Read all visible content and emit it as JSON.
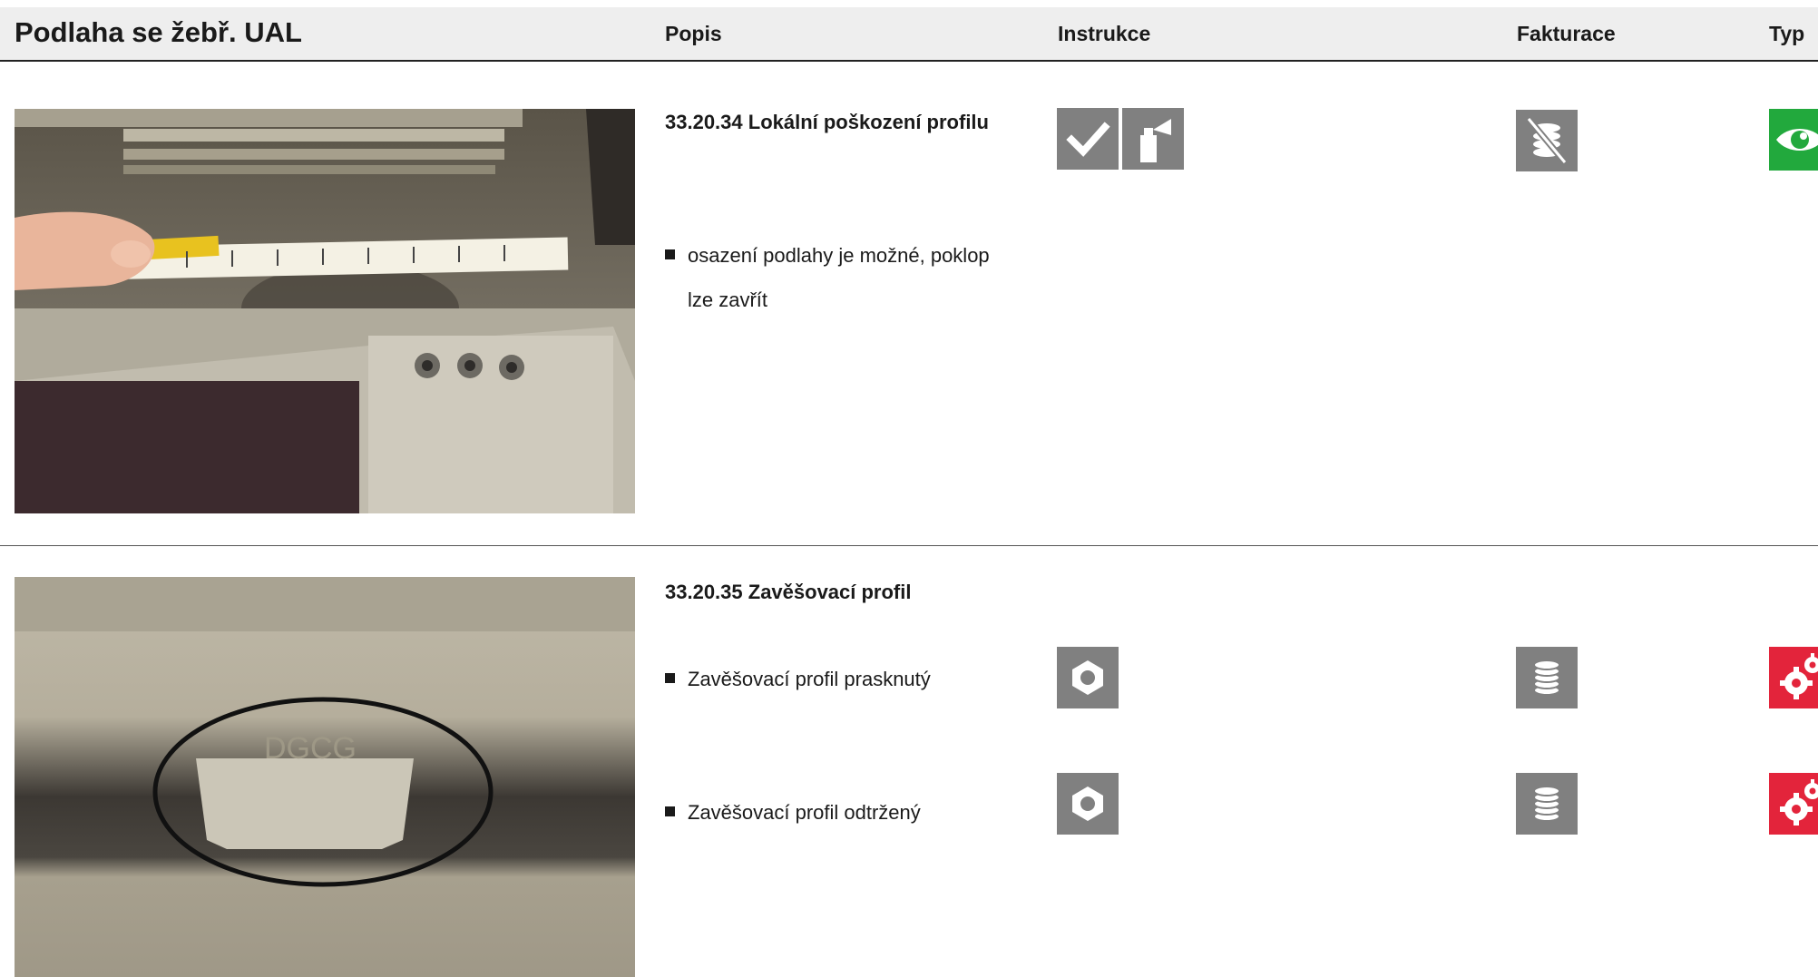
{
  "header": {
    "title": "Podlaha se žebř. UAL",
    "col_popis": "Popis",
    "col_instrukce": "Instrukce",
    "col_fakturace": "Fakturace",
    "col_typ": "Typ"
  },
  "items": [
    {
      "title": "33.20.34 Lokální poškození profilu",
      "bullets": [
        {
          "line1": "osazení podlahy je možné, poklop",
          "line2": "lze zavřít"
        }
      ],
      "instructions": [
        "check-icon",
        "spray-can-icon"
      ],
      "billing": [
        "no-billing-icon"
      ],
      "type": [
        "inspection-eye-icon"
      ]
    },
    {
      "title": "33.20.35 Zavěšovací profil",
      "bullets": [
        {
          "line1": "Zavěšovací profil  prasknutý"
        },
        {
          "line1": "Zavěšovací profil  odtržený"
        }
      ],
      "instructions": [
        "hex-nut-icon",
        "hex-nut-icon"
      ],
      "billing": [
        "coin-stack-icon",
        "coin-stack-icon"
      ],
      "type": [
        "repair-gears-icon",
        "repair-gears-icon"
      ]
    }
  ],
  "colors": {
    "header_background": "#eeeeee",
    "icon_grey": "#808080",
    "type_green": "#22a93d",
    "type_red": "#e3243b"
  }
}
